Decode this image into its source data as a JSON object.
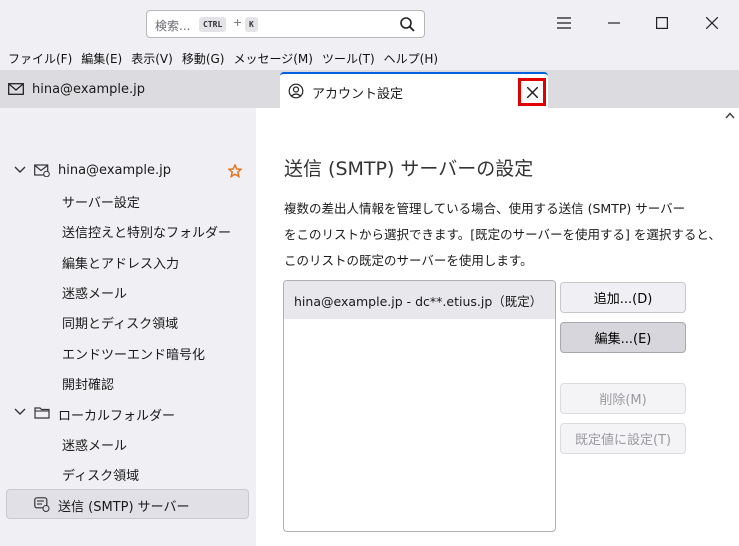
{
  "search": {
    "placeholder": "検索...",
    "kbd1": "CTRL",
    "plus": "+",
    "kbd2": "K"
  },
  "menu": [
    "ファイル(F)",
    "編集(E)",
    "表示(V)",
    "移動(G)",
    "メッセージ(M)",
    "ツール(T)",
    "ヘルプ(H)"
  ],
  "tabs": {
    "mail": "hina@example.jp",
    "settings": "アカウント設定"
  },
  "sidebar": {
    "account": "hina@example.jp",
    "account_items": [
      "サーバー設定",
      "送信控えと特別なフォルダー",
      "編集とアドレス入力",
      "迷惑メール",
      "同期とディスク領域",
      "エンドツーエンド暗号化",
      "開封確認"
    ],
    "local": "ローカルフォルダー",
    "local_items": [
      "迷惑メール",
      "ディスク領域"
    ],
    "smtp": "送信 (SMTP) サーバー"
  },
  "main": {
    "title": "送信 (SMTP) サーバーの設定",
    "desc_lines": [
      "複数の差出人情報を管理している場合、使用する送信 (SMTP) サーバー",
      "をこのリストから選択できます。[既定のサーバーを使用する] を選択すると、",
      "このリストの既定のサーバーを使用します。"
    ],
    "servers": [
      "hina@example.jp - dc**.etius.jp（既定）"
    ],
    "buttons": {
      "add": "追加...(D)",
      "edit": "編集...(E)",
      "delete": "削除(M)",
      "set_default": "既定値に設定(T)"
    }
  },
  "colors": {
    "accent": "#0061e0",
    "highlight_border": "#e00000",
    "star": "#e8711a"
  }
}
